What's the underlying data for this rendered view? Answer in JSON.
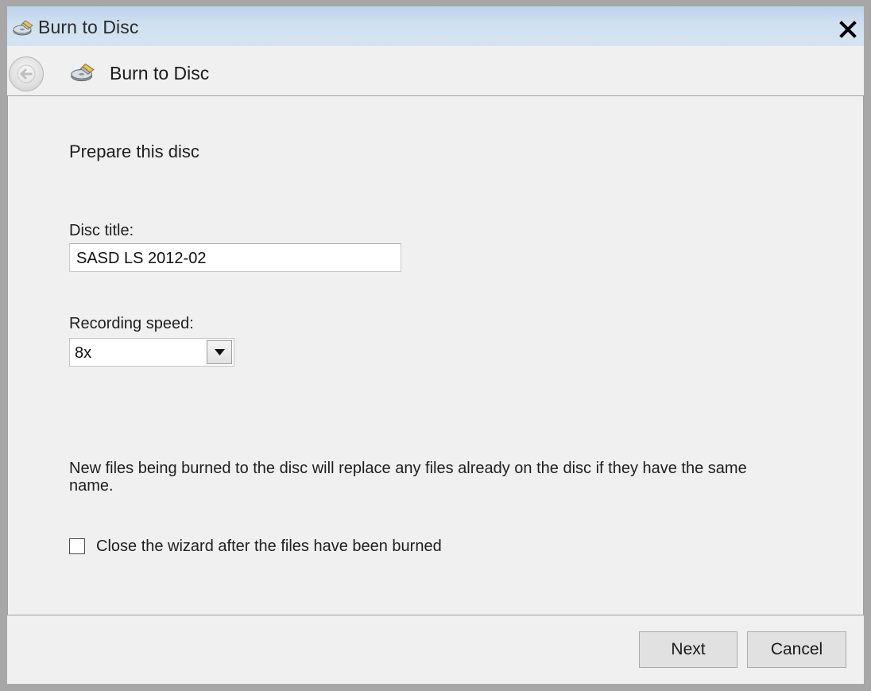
{
  "window": {
    "title": "Burn to Disc",
    "close_glyph": "✕"
  },
  "nav": {
    "title": "Burn to Disc",
    "back_icon": "back-arrow-icon",
    "app_icon": "disc-burner-icon"
  },
  "content": {
    "heading": "Prepare this disc",
    "disc_title_label": "Disc title:",
    "disc_title_value": "SASD LS 2012-02",
    "speed_label": "Recording speed:",
    "speed_value": "8x",
    "notice": "New files being burned to the disc will replace any files already on the disc if they have the same name.",
    "close_wizard_label": "Close the wizard after the files have been burned",
    "close_wizard_checked": false
  },
  "footer": {
    "next_label": "Next",
    "cancel_label": "Cancel"
  },
  "colors": {
    "titlebar": "#c4d8ee",
    "dialog_bg": "#f0f0f0",
    "button_bg": "#e1e1e1",
    "frame": "#a7a7a7"
  }
}
